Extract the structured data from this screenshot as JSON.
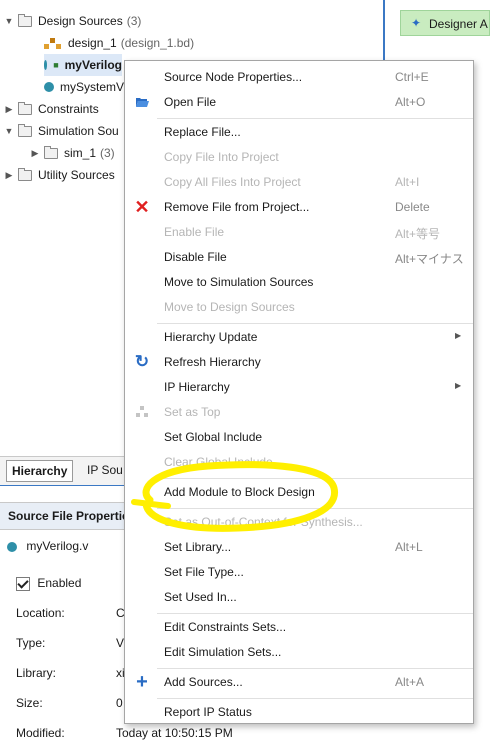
{
  "tree": {
    "design_sources": {
      "label": "Design Sources",
      "count": "(3)"
    },
    "design_1": {
      "label": "design_1",
      "detail": "(design_1.bd)"
    },
    "my_verilog": {
      "label": "myVerilog"
    },
    "my_system": {
      "label": "mySystemV"
    },
    "constraints": {
      "label": "Constraints"
    },
    "simulation_sources": {
      "label": "Simulation Sou"
    },
    "sim_1": {
      "label": "sim_1",
      "count": "(3)"
    },
    "utility_sources": {
      "label": "Utility Sources"
    }
  },
  "panel_tabs": {
    "hierarchy": "Hierarchy",
    "ip_sources": "IP Sou"
  },
  "properties": {
    "title": "Source File Propertie",
    "file_name": "myVerilog.v",
    "enabled_label": "Enabled",
    "rows": [
      {
        "label": "Location:",
        "value": "C"
      },
      {
        "label": "Type:",
        "value": "V"
      },
      {
        "label": "Library:",
        "value": "xi"
      },
      {
        "label": "Size:",
        "value": "0"
      },
      {
        "label": "Modified:",
        "value": "Today at 10:50:15 PM"
      }
    ]
  },
  "right_tab": {
    "label": "Designer A"
  },
  "menu": {
    "items": [
      {
        "label": "Source Node Properties...",
        "shortcut": "Ctrl+E",
        "disabled": false,
        "icon": ""
      },
      {
        "label": "Open File",
        "shortcut": "Alt+O",
        "disabled": false,
        "icon": "open-folder-icon"
      },
      {
        "label": "Replace File...",
        "shortcut": "",
        "disabled": false,
        "icon": ""
      },
      {
        "label": "Copy File Into Project",
        "shortcut": "",
        "disabled": true,
        "icon": ""
      },
      {
        "label": "Copy All Files Into Project",
        "shortcut": "Alt+I",
        "disabled": true,
        "icon": ""
      },
      {
        "label": "Remove File from Project...",
        "shortcut": "Delete",
        "disabled": false,
        "icon": "remove-x-icon"
      },
      {
        "label": "Enable File",
        "shortcut": "Alt+等号",
        "disabled": true,
        "icon": ""
      },
      {
        "label": "Disable File",
        "shortcut": "Alt+マイナス",
        "disabled": false,
        "icon": ""
      },
      {
        "label": "Move to Simulation Sources",
        "shortcut": "",
        "disabled": false,
        "icon": ""
      },
      {
        "label": "Move to Design Sources",
        "shortcut": "",
        "disabled": true,
        "icon": ""
      },
      {
        "label": "Hierarchy Update",
        "shortcut": "",
        "disabled": false,
        "icon": "",
        "submenu": true
      },
      {
        "label": "Refresh Hierarchy",
        "shortcut": "",
        "disabled": false,
        "icon": "refresh-icon"
      },
      {
        "label": "IP Hierarchy",
        "shortcut": "",
        "disabled": false,
        "icon": "",
        "submenu": true
      },
      {
        "label": "Set as Top",
        "shortcut": "",
        "disabled": true,
        "icon": "hierarchy-icon"
      },
      {
        "label": "Set Global Include",
        "shortcut": "",
        "disabled": false,
        "icon": ""
      },
      {
        "label": "Clear Global Include",
        "shortcut": "",
        "disabled": true,
        "icon": ""
      },
      {
        "label": "Add Module to Block Design",
        "shortcut": "",
        "disabled": false,
        "icon": ""
      },
      {
        "label": "Set as Out-of-Context for Synthesis...",
        "shortcut": "",
        "disabled": true,
        "icon": ""
      },
      {
        "label": "Set Library...",
        "shortcut": "Alt+L",
        "disabled": false,
        "icon": ""
      },
      {
        "label": "Set File Type...",
        "shortcut": "",
        "disabled": false,
        "icon": ""
      },
      {
        "label": "Set Used In...",
        "shortcut": "",
        "disabled": false,
        "icon": ""
      },
      {
        "label": "Edit Constraints Sets...",
        "shortcut": "",
        "disabled": false,
        "icon": ""
      },
      {
        "label": "Edit Simulation Sets...",
        "shortcut": "",
        "disabled": false,
        "icon": ""
      },
      {
        "label": "Add Sources...",
        "shortcut": "Alt+A",
        "disabled": false,
        "icon": "plus-icon"
      },
      {
        "label": "Report IP Status",
        "shortcut": "",
        "disabled": false,
        "icon": ""
      }
    ]
  },
  "colors": {
    "accent": "#3b78c4",
    "highlight": "#ffef00",
    "remove": "#e02020",
    "teal": "#2e8fa8"
  }
}
